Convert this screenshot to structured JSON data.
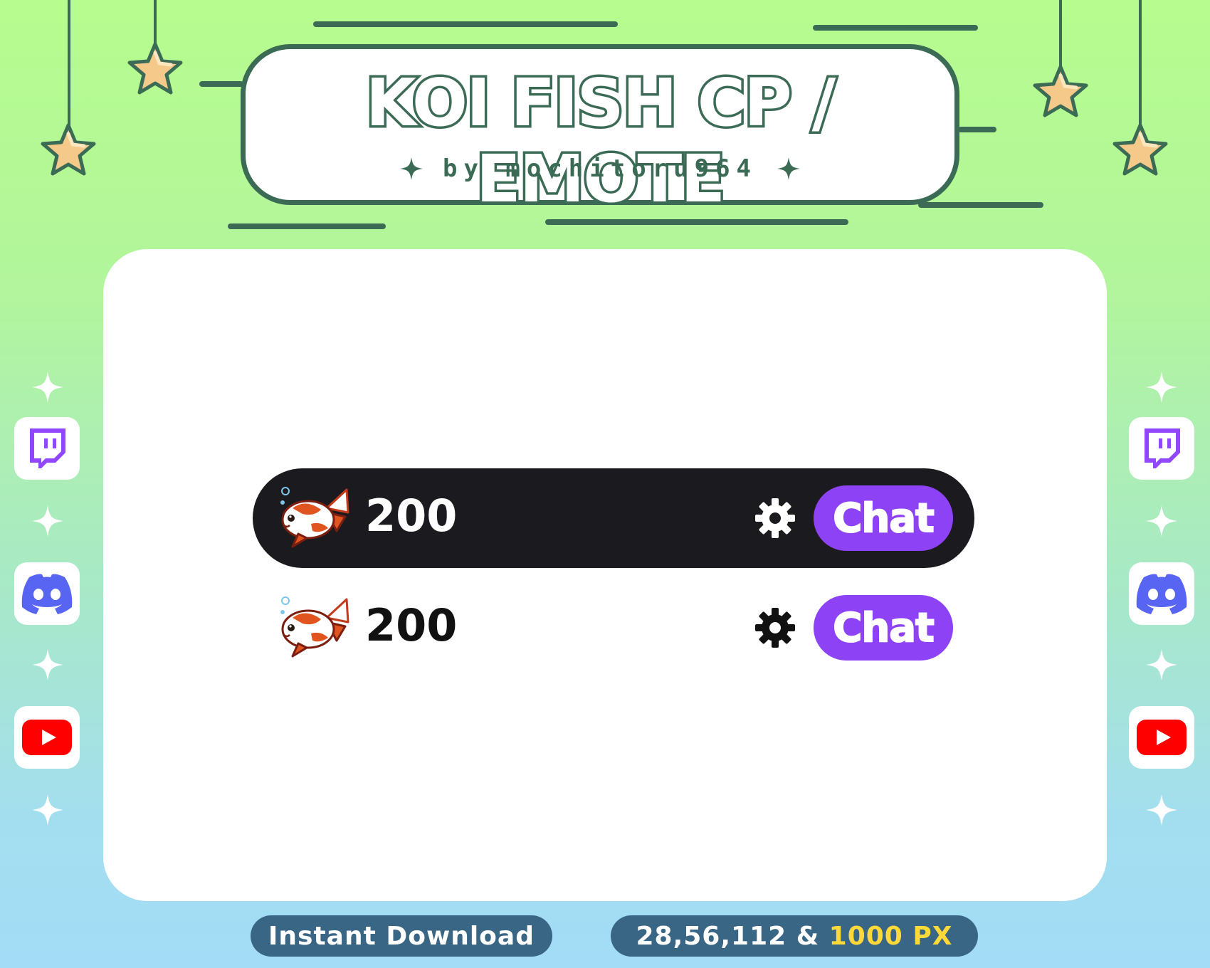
{
  "header": {
    "title": "KOI FISH CP / EMOTE",
    "subtitle": "by mochitoru964"
  },
  "rows": [
    {
      "count": "200",
      "button_label": "Chat",
      "theme": "dark"
    },
    {
      "count": "200",
      "button_label": "Chat",
      "theme": "light"
    }
  ],
  "footer": {
    "download_label": "Instant Download",
    "sizes_label": "28,56,112 &",
    "sizes_highlight": "1000 PX"
  },
  "social_icons": [
    "twitch-icon",
    "discord-icon",
    "youtube-icon"
  ],
  "colors": {
    "accent_green": "#3b6b55",
    "chat_button": "#8d43f5",
    "dark_bar": "#1b1a1f",
    "pill_bg": "#3a6686",
    "highlight": "#ffd83a",
    "twitch": "#9146ff",
    "discord": "#5865f2",
    "youtube": "#ff0000"
  }
}
